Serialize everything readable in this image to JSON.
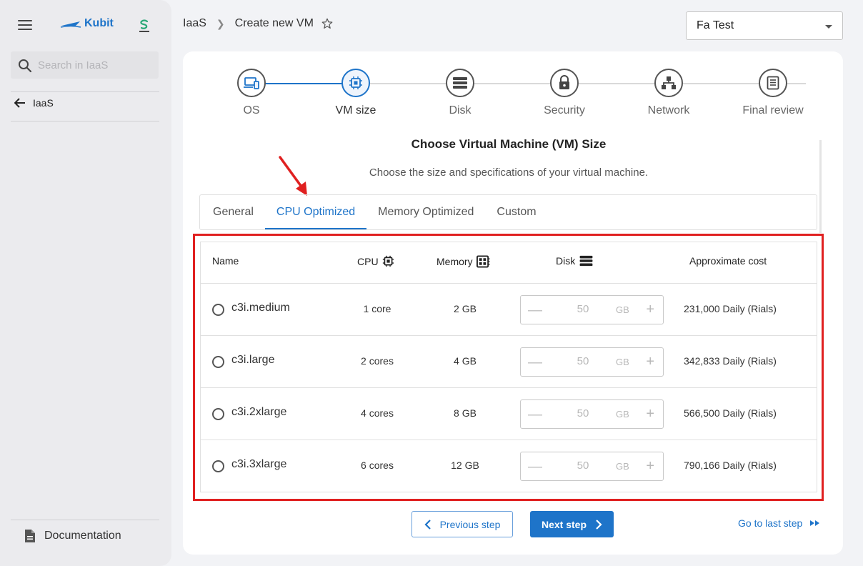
{
  "sidebar": {
    "brand": "Kubit",
    "search_placeholder": "Search in IaaS",
    "back_label": "IaaS",
    "documentation_label": "Documentation"
  },
  "header": {
    "breadcrumb": [
      "IaaS",
      "Create new VM"
    ],
    "tenant": "Fa Test"
  },
  "stepper": {
    "steps": [
      {
        "label": "OS",
        "icon": "devices-icon"
      },
      {
        "label": "VM size",
        "icon": "cpu-chip-icon"
      },
      {
        "label": "Disk",
        "icon": "storage-icon"
      },
      {
        "label": "Security",
        "icon": "lock-icon"
      },
      {
        "label": "Network",
        "icon": "network-icon"
      },
      {
        "label": "Final review",
        "icon": "review-list-icon"
      }
    ],
    "active_index": 1
  },
  "content": {
    "title": "Choose Virtual Machine (VM) Size",
    "subtitle": "Choose the size and specifications of your virtual machine."
  },
  "tabs": [
    {
      "label": "General"
    },
    {
      "label": "CPU Optimized"
    },
    {
      "label": "Memory Optimized"
    },
    {
      "label": "Custom"
    }
  ],
  "active_tab": "CPU Optimized",
  "table": {
    "columns": {
      "name": "Name",
      "cpu": "CPU",
      "memory": "Memory",
      "disk": "Disk",
      "cost": "Approximate cost"
    },
    "rows": [
      {
        "name": "c3i.medium",
        "cpu": "1 core",
        "memory": "2 GB",
        "disk": "50",
        "disk_unit": "GB",
        "cost": "231,000 Daily (Rials)"
      },
      {
        "name": "c3i.large",
        "cpu": "2 cores",
        "memory": "4 GB",
        "disk": "50",
        "disk_unit": "GB",
        "cost": "342,833 Daily (Rials)"
      },
      {
        "name": "c3i.2xlarge",
        "cpu": "4 cores",
        "memory": "8 GB",
        "disk": "50",
        "disk_unit": "GB",
        "cost": "566,500 Daily (Rials)"
      },
      {
        "name": "c3i.3xlarge",
        "cpu": "6 cores",
        "memory": "12 GB",
        "disk": "50",
        "disk_unit": "GB",
        "cost": "790,166 Daily (Rials)"
      }
    ]
  },
  "footer": {
    "prev_label": "Previous step",
    "next_label": "Next step",
    "last_label": "Go to last step"
  },
  "colors": {
    "accent": "#1e74c9",
    "highlight": "#e02020"
  }
}
